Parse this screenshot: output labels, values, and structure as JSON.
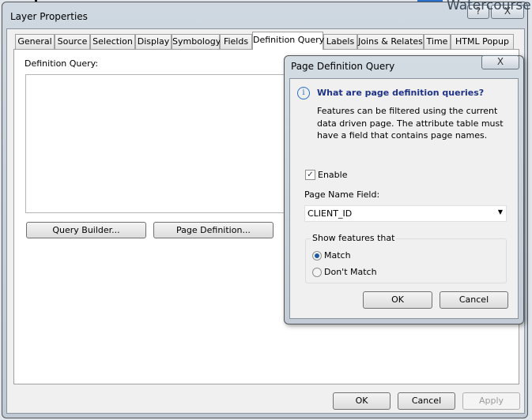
{
  "background": {
    "text": "Watercourse"
  },
  "window": {
    "title": "Layer Properties",
    "help": "?",
    "close": "X"
  },
  "tabs": [
    {
      "label": "General"
    },
    {
      "label": "Source"
    },
    {
      "label": "Selection"
    },
    {
      "label": "Display"
    },
    {
      "label": "Symbology"
    },
    {
      "label": "Fields"
    },
    {
      "label": "Definition Query",
      "selected": true
    },
    {
      "label": "Labels"
    },
    {
      "label": "Joins & Relates"
    },
    {
      "label": "Time"
    },
    {
      "label": "HTML Popup"
    }
  ],
  "panel": {
    "label": "Definition Query:",
    "query_value": "",
    "query_builder": "Query Builder...",
    "page_definition": "Page Definition..."
  },
  "footer": {
    "ok": "OK",
    "cancel": "Cancel",
    "apply": "Apply"
  },
  "dialog": {
    "title": "Page Definition Query",
    "close": "X",
    "info_icon": "info-icon",
    "heading": "What are page definition queries?",
    "desc": [
      "Features can be filtered using the current",
      "data driven page.  The attribute table must",
      "have a field that contains page names."
    ],
    "enable_label": "Enable",
    "enable_checked": true,
    "field_label": "Page Name Field:",
    "field_value": "CLIENT_ID",
    "group_label": "Show features that",
    "match": "Match",
    "dont_match": "Don't Match",
    "selected": "Match",
    "ok": "OK",
    "cancel": "Cancel",
    "heading_color": "#1e3287"
  }
}
